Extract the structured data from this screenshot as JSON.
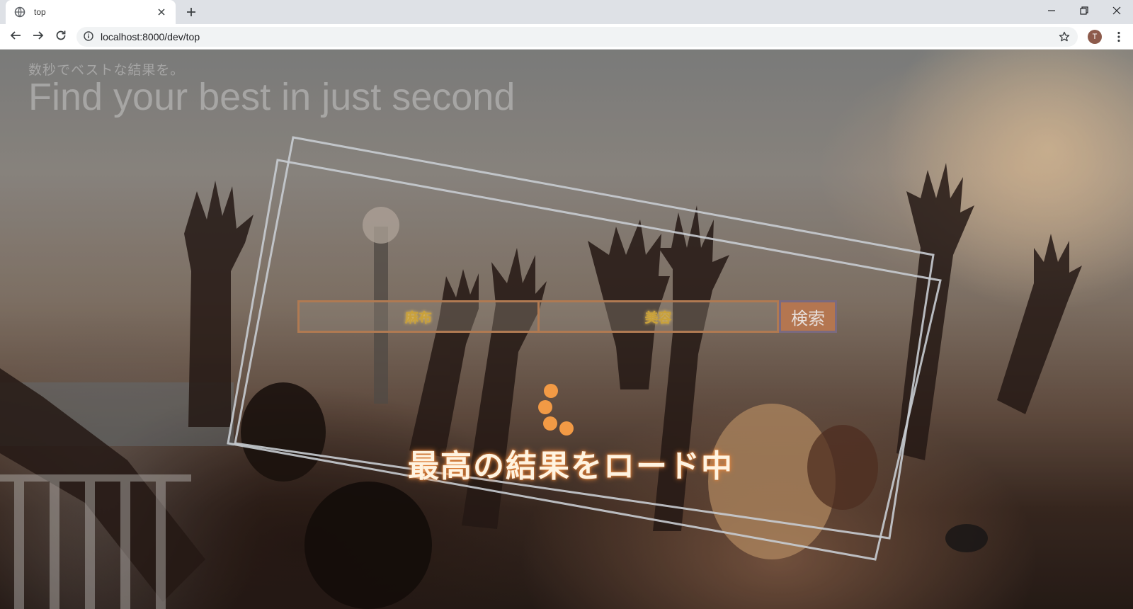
{
  "browser": {
    "tab_title": "top",
    "url": "localhost:8000/dev/top",
    "profile_initial": "T",
    "icons": [
      "globe-icon",
      "close-icon",
      "plus-icon",
      "back-icon",
      "forward-icon",
      "reload-icon",
      "info-icon",
      "star-icon",
      "minimize-icon",
      "restore-icon",
      "window-close-icon",
      "more-vert-icon"
    ]
  },
  "page": {
    "subtitle": "数秒でベストな結果を。",
    "headline": "Find your best in just second",
    "search": {
      "area_value": "麻布",
      "genre_value": "美容",
      "button_label": "検索"
    },
    "loading_text": "最高の結果をロード中",
    "colors": {
      "accent_orange": "#f29a45",
      "frame_stroke": "#c8ccd2",
      "button_bg": "#b47650"
    }
  }
}
